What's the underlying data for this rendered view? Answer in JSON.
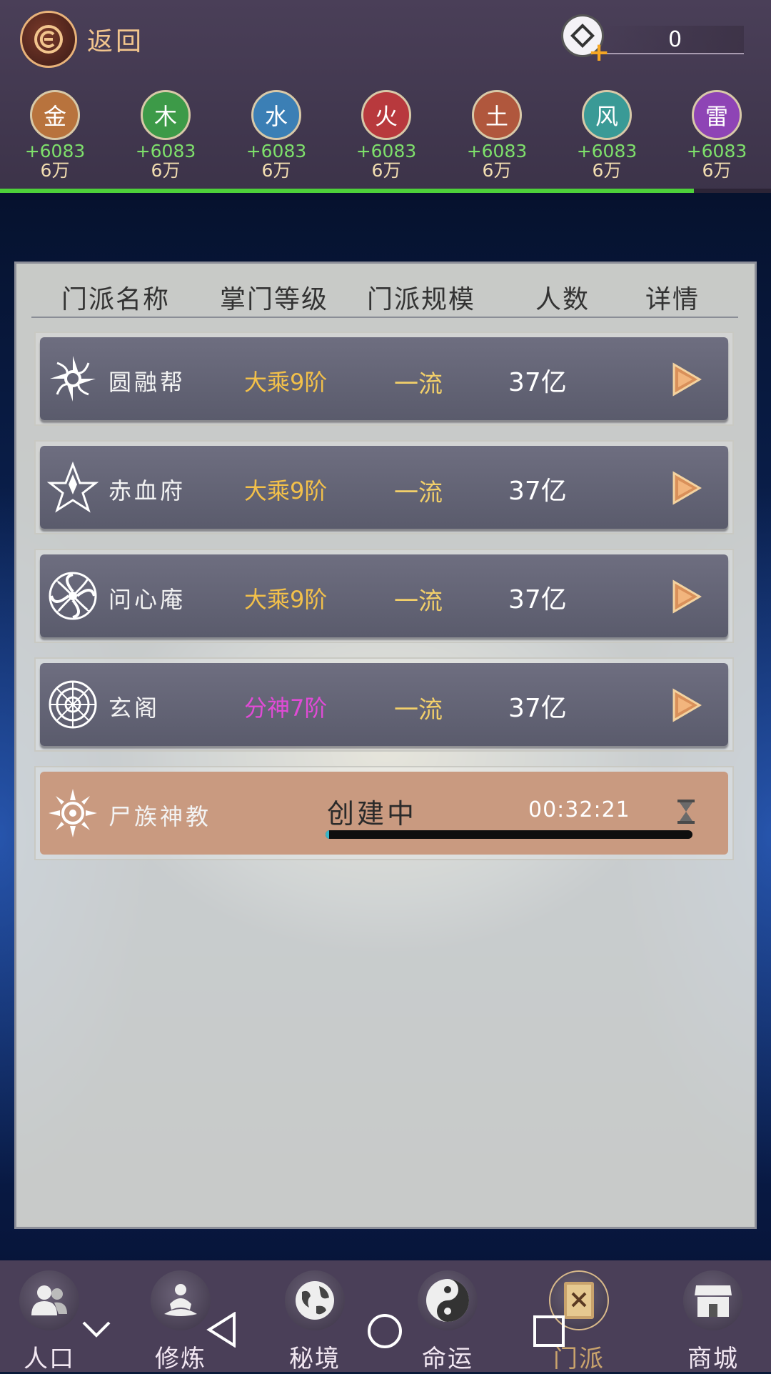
{
  "header": {
    "back_label": "返回",
    "coin_value": "0",
    "coin_plus": "+",
    "elements": [
      {
        "char": "金",
        "gain": "+6083",
        "total": "6万",
        "color": "#b8733d"
      },
      {
        "char": "木",
        "gain": "+6083",
        "total": "6万",
        "color": "#3d9a48"
      },
      {
        "char": "水",
        "gain": "+6083",
        "total": "6万",
        "color": "#3b7fb5"
      },
      {
        "char": "火",
        "gain": "+6083",
        "total": "6万",
        "color": "#b8393d"
      },
      {
        "char": "土",
        "gain": "+6083",
        "total": "6万",
        "color": "#b0573d"
      },
      {
        "char": "风",
        "gain": "+6083",
        "total": "6万",
        "color": "#3a9a96"
      },
      {
        "char": "雷",
        "gain": "+6083",
        "total": "6万",
        "color": "#8e44b5"
      }
    ],
    "progress_fraction": 0.9
  },
  "table": {
    "headers": {
      "name": "门派名称",
      "leader_level": "掌门等级",
      "scale": "门派规模",
      "members": "人数",
      "details": "详情"
    },
    "rows": [
      {
        "name": "圆融帮",
        "level": "大乘9阶",
        "level_color": "#f2c04a",
        "scale": "一流",
        "members": "37亿",
        "icon": "shuriken-icon"
      },
      {
        "name": "赤血府",
        "level": "大乘9阶",
        "level_color": "#f2c04a",
        "scale": "一流",
        "members": "37亿",
        "icon": "star-icon"
      },
      {
        "name": "问心庵",
        "level": "大乘9阶",
        "level_color": "#f2c04a",
        "scale": "一流",
        "members": "37亿",
        "icon": "swirl-icon"
      },
      {
        "name": "玄阁",
        "level": "分神7阶",
        "level_color": "#e04bd6",
        "scale": "一流",
        "members": "37亿",
        "icon": "compass-icon"
      }
    ],
    "creating": {
      "name": "尸族神教",
      "status": "创建中",
      "timer": "00:32:21",
      "progress_fraction": 0.01,
      "icon": "sun-icon"
    }
  },
  "bottom_nav": [
    {
      "label": "人口",
      "icon": "people-icon"
    },
    {
      "label": "修炼",
      "icon": "meditate-icon"
    },
    {
      "label": "秘境",
      "icon": "globe-icon"
    },
    {
      "label": "命运",
      "icon": "yin-yang-icon"
    },
    {
      "label": "门派",
      "icon": "sect-book-icon",
      "active": true
    },
    {
      "label": "商城",
      "icon": "shop-icon"
    }
  ]
}
